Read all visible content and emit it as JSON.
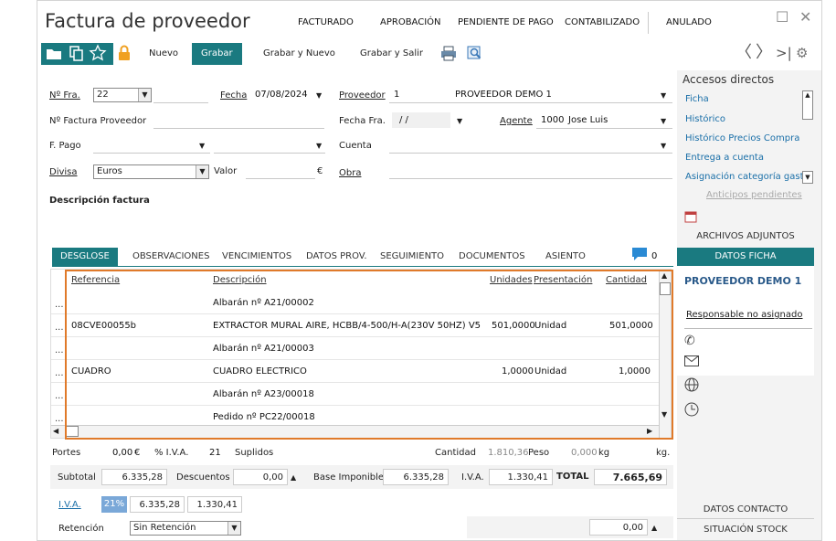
{
  "window": {
    "title": "Factura de proveedor"
  },
  "top_nav": [
    "FACTURADO",
    "APROBACIÓN",
    "PENDIENTE DE PAGO",
    "CONTABILIZADO",
    "ANULADO"
  ],
  "toolbar": {
    "nuevo": "Nuevo",
    "grabar": "Grabar",
    "grabar_nuevo": "Grabar y Nuevo",
    "grabar_salir": "Grabar y Salir"
  },
  "form": {
    "nfra_label": "Nº Fra.",
    "nfra_value": "22",
    "fecha_label": "Fecha",
    "fecha_value": "07/08/2024",
    "proveedor_label": "Proveedor",
    "proveedor_code": "1",
    "proveedor_name": "PROVEEDOR DEMO 1",
    "nfactura_label": "Nº Factura Proveedor",
    "fechafra_label": "Fecha Fra.",
    "fechafra_value": "/ /",
    "agente_label": "Agente",
    "agente_code": "1000",
    "agente_name": "Jose Luis",
    "fpago_label": "F. Pago",
    "cuenta_label": "Cuenta",
    "divisa_label": "Divisa",
    "divisa_value": "Euros",
    "valor_label": "Valor",
    "valor_symbol": "€",
    "obra_label": "Obra",
    "descripcion_label": "Descripción factura"
  },
  "tabs": [
    "DESGLOSE",
    "OBSERVACIONES",
    "VENCIMIENTOS",
    "DATOS PROV.",
    "SEGUIMIENTO",
    "DOCUMENTOS",
    "ASIENTO"
  ],
  "comments_count": "0",
  "grid": {
    "headers": {
      "ref": "Referencia",
      "desc": "Descripción",
      "unidades": "Unidades",
      "presentacion": "Presentación",
      "cantidad": "Cantidad"
    },
    "dots": "...",
    "rows": [
      {
        "ref": "",
        "desc": "Albarán nº A21/00002",
        "unidades": "",
        "presentacion": "",
        "cantidad": ""
      },
      {
        "ref": "08CVE00055b",
        "desc": "EXTRACTOR MURAL AIRE, HCBB/4-500/H-A(230V 50HZ) V5",
        "unidades": "501,0000",
        "presentacion": "Unidad",
        "cantidad": "501,0000"
      },
      {
        "ref": "",
        "desc": "Albarán nº A21/00003",
        "unidades": "",
        "presentacion": "",
        "cantidad": ""
      },
      {
        "ref": "CUADRO",
        "desc": "CUADRO ELECTRICO",
        "unidades": "1,0000",
        "presentacion": "Unidad",
        "cantidad": "1,0000"
      },
      {
        "ref": "",
        "desc": "Albarán nº A23/00018",
        "unidades": "",
        "presentacion": "",
        "cantidad": ""
      },
      {
        "ref": "",
        "desc": "Pedido nº PC22/00018",
        "unidades": "",
        "presentacion": "",
        "cantidad": ""
      }
    ]
  },
  "footer": {
    "portes_label": "Portes",
    "portes_value": "0,00",
    "portes_symbol": "€",
    "iva_pct_label": "% I.V.A.",
    "iva_pct_value": "21",
    "suplidos_label": "Suplidos",
    "cantidad_label": "Cantidad",
    "cantidad_value": "1.810,36",
    "peso_label": "Peso",
    "peso_value": "0,000",
    "kg1": "kg",
    "kg2": "kg.",
    "subtotal_label": "Subtotal",
    "subtotal_value": "6.335,28",
    "descuentos_label": "Descuentos",
    "descuentos_value": "0,00",
    "base_label": "Base Imponible",
    "base_value": "6.335,28",
    "iva_label": "I.V.A.",
    "iva_value": "1.330,41",
    "total_label": "TOTAL",
    "total_value": "7.665,69",
    "iva_row_label": "I.V.A.",
    "iva_row_pct": "21%",
    "iva_row_base": "6.335,28",
    "iva_row_amount": "1.330,41",
    "retencion_label": "Retención",
    "retencion_value": "Sin Retención",
    "retencion_amount": "0,00"
  },
  "sidebar": {
    "title": "Accesos directos",
    "links": [
      "Ficha",
      "Histórico",
      "Histórico Precios Compra",
      "Entrega a cuenta",
      "Asignación categoría gast"
    ],
    "disabled_link": "Anticipos pendientes",
    "archivos": "ARCHIVOS ADJUNTOS",
    "datos_ficha": "DATOS FICHA",
    "prov_name": "PROVEEDOR DEMO 1",
    "responsable": "Responsable no asignado",
    "datos_contacto": "DATOS CONTACTO",
    "situacion_stock": "SITUACIÓN STOCK"
  },
  "colors": {
    "accent": "#1a7a80",
    "highlight": "#e07a2a"
  }
}
